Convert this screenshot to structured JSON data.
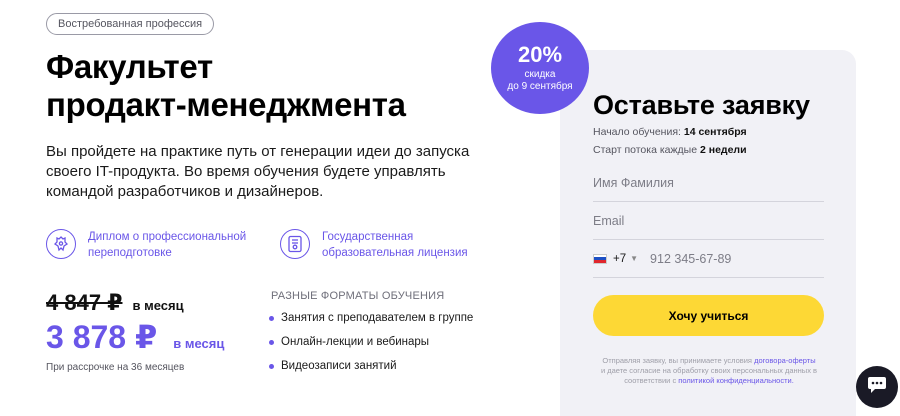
{
  "badge": "Востребованная профессия",
  "title": [
    "Факультет",
    "продакт-менеджмента"
  ],
  "description": [
    "Вы пройдете на практике путь от генерации идеи до запуска",
    "своего IT-продукта. Во время обучения будете управлять",
    "командой разработчиков и дизайнеров."
  ],
  "features": [
    {
      "icon": "emblem-icon",
      "lines": [
        "Диплом о профессиональной",
        "переподготовке"
      ]
    },
    {
      "icon": "license-icon",
      "lines": [
        "Государственная",
        "образовательная лицензия"
      ]
    }
  ],
  "price": {
    "old": "4 847 ₽",
    "old_period": "в месяц",
    "new": "3 878 ₽",
    "new_period": "в месяц",
    "installment": "При рассрочке на 36 месяцев"
  },
  "formats": {
    "title": "РАЗНЫЕ ФОРМАТЫ ОБУЧЕНИЯ",
    "items": [
      "Занятия с преподавателем в группе",
      "Онлайн-лекции и вебинары",
      "Видеозаписи занятий"
    ]
  },
  "discount": {
    "percent": "20%",
    "line1": "скидка",
    "line2": "до 9 сентября"
  },
  "form": {
    "title": "Оставьте заявку",
    "start_label": "Начало обучения:",
    "start_value": "14 сентября",
    "stream_label": "Старт потока каждые",
    "stream_value": "2 недели",
    "name_placeholder": "Имя Фамилия",
    "email_placeholder": "Email",
    "phone_code": "+7",
    "phone_placeholder": "912 345-67-89",
    "submit": "Хочу учиться",
    "legal_1": "Отправляя заявку, вы принимаете условия",
    "legal_link_1": "договора-оферты",
    "legal_2": "и даете согласие на обработку своих персональных данных в соответствии с",
    "legal_link_2": "политикой конфиденциальности."
  },
  "colors": {
    "accent": "#6a56e8",
    "button": "#fdd835",
    "panel": "#f1f1f6",
    "chat": "#1a1a26"
  },
  "icons": {
    "chat": "chat-bubble-icon",
    "flag": "russia-flag-icon"
  }
}
